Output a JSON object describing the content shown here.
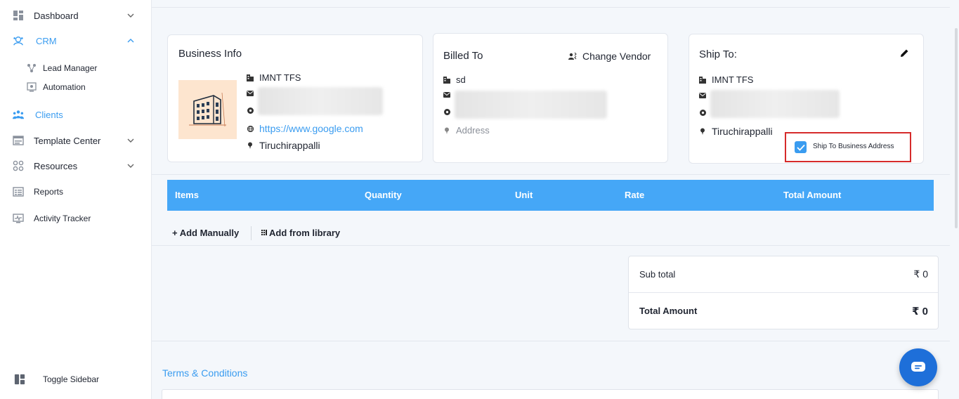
{
  "sidebar": {
    "items": [
      {
        "label": "Dashboard",
        "icon": "dashboard-icon",
        "has_chevron": true,
        "chevron": "down"
      },
      {
        "label": "CRM",
        "icon": "crm-icon",
        "has_chevron": true,
        "chevron": "up",
        "active": true
      },
      {
        "label": "Clients",
        "icon": "clients-icon",
        "active": true
      },
      {
        "label": "Template Center",
        "icon": "template-icon",
        "has_chevron": true,
        "chevron": "down"
      },
      {
        "label": "Resources",
        "icon": "resources-icon",
        "has_chevron": true,
        "chevron": "down"
      },
      {
        "label": "Reports",
        "icon": "reports-icon"
      },
      {
        "label": "Activity Tracker",
        "icon": "activity-icon"
      }
    ],
    "sub_items": [
      {
        "label": "Lead Manager",
        "icon": "lead-manager-icon"
      },
      {
        "label": "Automation",
        "icon": "automation-icon"
      }
    ],
    "toggle_label": "Toggle Sidebar"
  },
  "business_info": {
    "title": "Business Info",
    "name": "IMNT TFS",
    "website": "https://www.google.com",
    "city": "Tiruchirappalli"
  },
  "billed_to": {
    "title": "Billed To",
    "change_vendor_label": "Change Vendor",
    "name": "sd",
    "address_placeholder": "Address"
  },
  "ship_to": {
    "title": "Ship To:",
    "name": "IMNT TFS",
    "city": "Tiruchirappalli",
    "checkbox_label": "Ship To Business Address",
    "checkbox_checked": true
  },
  "items_table": {
    "columns": [
      "Items",
      "Quantity",
      "Unit",
      "Rate",
      "Total Amount"
    ]
  },
  "actions": {
    "add_manually": "+ Add Manually",
    "add_library": "Add from library"
  },
  "totals": {
    "subtotal_label": "Sub total",
    "subtotal_value": "₹ 0",
    "total_label": "Total Amount",
    "total_value": "₹ 0"
  },
  "terms": {
    "title": "Terms & Conditions"
  },
  "colors": {
    "accent": "#3a9cf0",
    "table_header": "#45a7f7",
    "highlight_border": "#d62b2b",
    "chat_button": "#1e6fd9"
  }
}
